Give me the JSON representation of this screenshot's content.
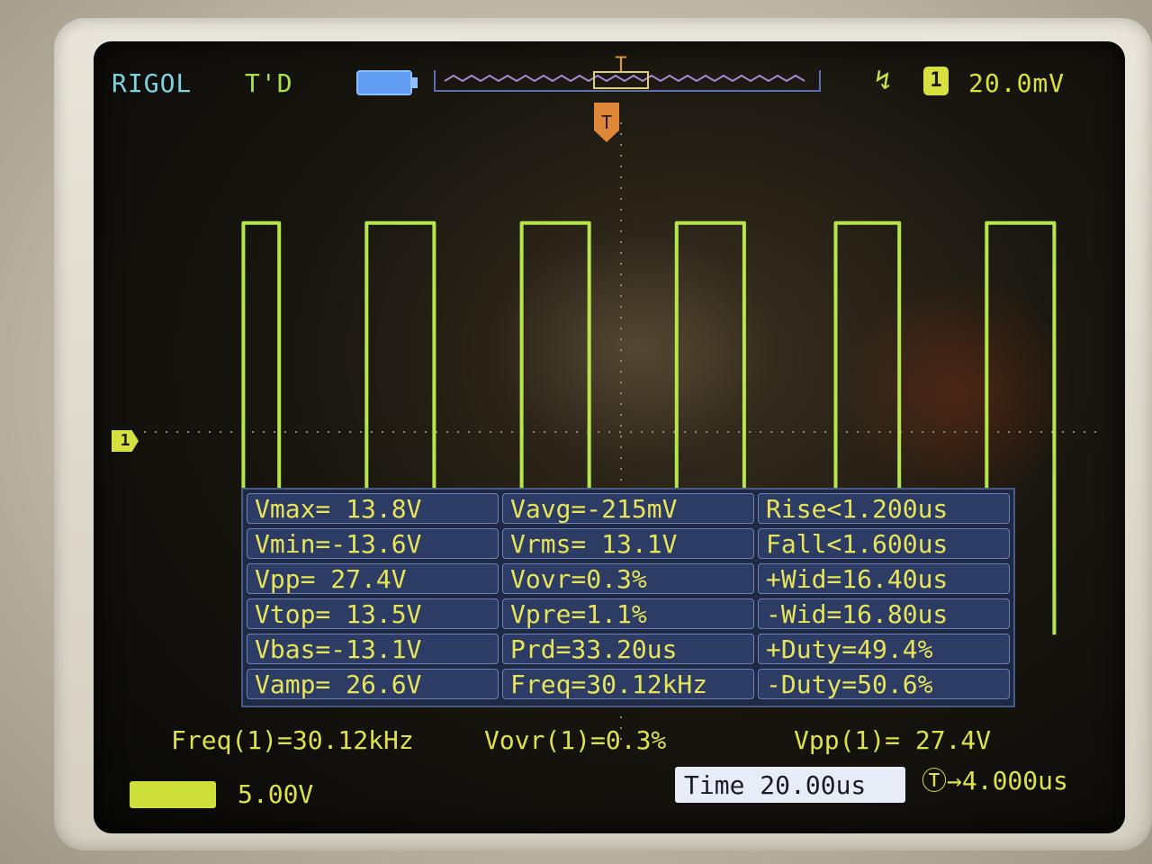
{
  "status_bar": {
    "brand": "RIGOL",
    "trigger_status": "T'D",
    "trigger_position_label": "T",
    "trigger_marker_label": "T",
    "trigger_edge_icon": "rising-edge-icon",
    "trigger_channel": "1",
    "trigger_level": "20.0mV"
  },
  "channel1_marker": "1",
  "measurements": [
    [
      "Vmax= 13.8V",
      "Vavg=-215mV",
      "Rise<1.200us"
    ],
    [
      "Vmin=-13.6V",
      "Vrms= 13.1V",
      "Fall<1.600us"
    ],
    [
      "Vpp= 27.4V",
      "Vovr=0.3%",
      "+Wid=16.40us"
    ],
    [
      "Vtop= 13.5V",
      "Vpre=1.1%",
      "-Wid=16.80us"
    ],
    [
      "Vbas=-13.1V",
      "Prd=33.20us",
      "+Duty=49.4%"
    ],
    [
      "Vamp= 26.6V",
      "Freq=30.12kHz",
      "-Duty=50.6%"
    ]
  ],
  "bottom_measurements": {
    "freq": "Freq(1)=30.12kHz",
    "vovr": "Vovr(1)=0.3%",
    "vpp": "Vpp(1)= 27.4V"
  },
  "channel_scale": "5.00V",
  "timebase": "Time 20.00us",
  "trigger_offset": "Ⓣ→4.000us",
  "colors": {
    "trace": "#b6e64a",
    "brand": "#7fd2e0",
    "text": "#dde24a",
    "panel": "#2c3c64"
  },
  "chart_data": {
    "type": "line",
    "title": "",
    "xlabel": "",
    "ylabel": "",
    "x_unit": "us",
    "y_unit": "V",
    "series": [
      {
        "x": [
          -95,
          -95,
          -86,
          -86,
          -64,
          -64,
          -47,
          -47,
          -25,
          -25,
          -8,
          -8,
          14,
          14,
          31,
          31,
          54,
          54,
          70,
          70,
          92,
          92,
          109,
          109
        ],
        "y": [
          -13.1,
          13.5,
          13.5,
          -13.1,
          -13.1,
          13.5,
          13.5,
          -13.1,
          -13.1,
          13.5,
          13.5,
          -13.1,
          -13.1,
          13.5,
          13.5,
          -13.1,
          -13.1,
          13.5,
          13.5,
          -13.1,
          -13.1,
          13.5,
          13.5,
          -13.1
        ]
      }
    ],
    "xlim": [
      -120,
      120
    ],
    "ylim": [
      -20,
      20
    ],
    "grid": true
  }
}
